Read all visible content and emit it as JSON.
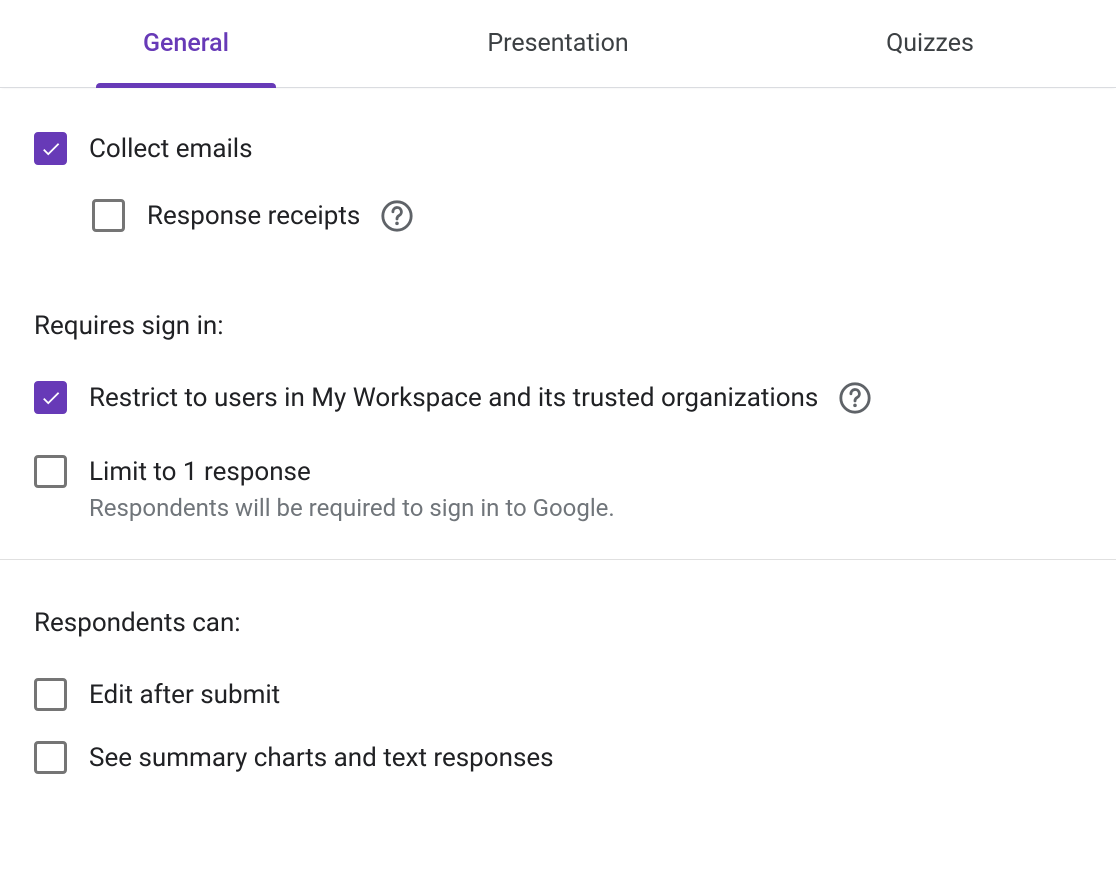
{
  "colors": {
    "accent": "#673ab7"
  },
  "tabs": {
    "general": "General",
    "presentation": "Presentation",
    "quizzes": "Quizzes",
    "active": "general"
  },
  "settings": {
    "collect_emails": {
      "label": "Collect emails",
      "checked": true
    },
    "response_receipts": {
      "label": "Response receipts",
      "checked": false
    },
    "requires_signin_heading": "Requires sign in:",
    "restrict_workspace": {
      "label": "Restrict to users in My Workspace and its trusted organizations",
      "checked": true
    },
    "limit_one": {
      "label": "Limit to 1 response",
      "sub": "Respondents will be required to sign in to Google.",
      "checked": false
    },
    "respondents_heading": "Respondents can:",
    "edit_after_submit": {
      "label": "Edit after submit",
      "checked": false
    },
    "see_summary": {
      "label": "See summary charts and text responses",
      "checked": false
    }
  }
}
